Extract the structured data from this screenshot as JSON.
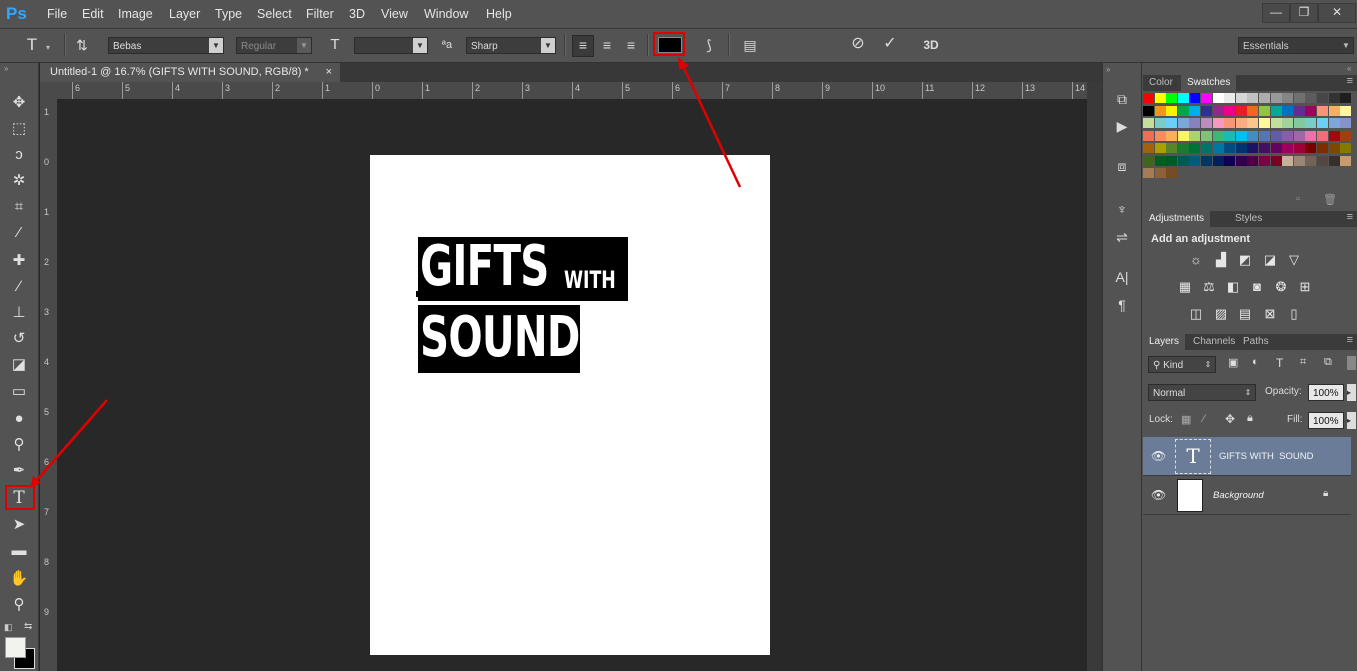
{
  "app": {
    "logo": "Ps"
  },
  "menu": [
    "File",
    "Edit",
    "Image",
    "Layer",
    "Type",
    "Select",
    "Filter",
    "3D",
    "View",
    "Window",
    "Help"
  ],
  "window_controls": {
    "minimize": "—",
    "restore": "❐",
    "close": "✕"
  },
  "options": {
    "font_family": "Bebas",
    "font_style": "Regular",
    "font_size": "",
    "antialias": "Sharp",
    "text_color": "#000000",
    "workspace": "Essentials"
  },
  "document": {
    "tab_title": "Untitled-1 @ 16.7% (GIFTS WITH  SOUND, RGB/8) *",
    "tab_close": "×",
    "line1_big": "GIFTS",
    "line1_small": "WITH",
    "line2": "SOUND"
  },
  "ruler": {
    "h": [
      "6",
      "5",
      "4",
      "3",
      "2",
      "1",
      "0",
      "1",
      "2",
      "3",
      "4",
      "5",
      "6",
      "7",
      "8",
      "9",
      "10",
      "11",
      "12",
      "13",
      "14"
    ],
    "v": [
      "1",
      "0",
      "1",
      "2",
      "3",
      "4",
      "5",
      "6",
      "7",
      "8",
      "9"
    ]
  },
  "panels": {
    "color_tab": "Color",
    "swatches_tab": "Swatches",
    "adjustments_tab": "Adjustments",
    "styles_tab": "Styles",
    "add_adjustment": "Add an adjustment",
    "layers_tab": "Layers",
    "channels_tab": "Channels",
    "paths_tab": "Paths",
    "kind_label": "Kind",
    "blend_mode": "Normal",
    "opacity_label": "Opacity:",
    "opacity_value": "100%",
    "lock_label": "Lock:",
    "fill_label": "Fill:",
    "fill_value": "100%"
  },
  "layers": [
    {
      "name": "GIFTS WITH  SOUND",
      "type": "text",
      "selected": true
    },
    {
      "name": "Background",
      "type": "background",
      "locked": true
    }
  ],
  "swatch_colors": [
    [
      "#ff0000",
      "#ffff00",
      "#00ff00",
      "#00ffff",
      "#0000ff",
      "#ff00ff",
      "#ffffff",
      "#ebebeb",
      "#d6d6d6",
      "#c2c2c2",
      "#adadad",
      "#999999",
      "#858585",
      "#707070",
      "#5c5c5c",
      "#474747",
      "#333333",
      "#1f1f1f"
    ],
    [
      "#000000",
      "#f7941d",
      "#fff200",
      "#00a651",
      "#00aeef",
      "#2e3192",
      "#92278f",
      "#ec008c",
      "#ed1c24",
      "#f26522",
      "#8dc63f",
      "#00a99d",
      "#0072bc",
      "#662d91",
      "#9e005d",
      "#f69679",
      "#fbaf5d",
      "#fff799"
    ],
    [
      "#c4df9b",
      "#7accc8",
      "#6dcff6",
      "#7da7d9",
      "#8781bd",
      "#bd8cbf",
      "#f49ac1",
      "#f7977a",
      "#f9ad81",
      "#fdc68a",
      "#fff79a",
      "#c4df9b",
      "#a2d39c",
      "#82ca9c",
      "#7bcdc8",
      "#6ecff6",
      "#7ea7d8",
      "#8493ca"
    ],
    [
      "#f26c4f",
      "#f68e55",
      "#fbaf5c",
      "#fff467",
      "#acd372",
      "#7cc576",
      "#3bb878",
      "#1abbb4",
      "#00bff3",
      "#438ccb",
      "#5574b9",
      "#605ca8",
      "#855fa8",
      "#a763a8",
      "#f06ea9",
      "#f26d7d",
      "#9e0b0f",
      "#a0410d"
    ],
    [
      "#a36209",
      "#aba000",
      "#598527",
      "#1a7b30",
      "#007236",
      "#00746b",
      "#0076a3",
      "#004b80",
      "#003471",
      "#1b1464",
      "#440e62",
      "#630460",
      "#9e005d",
      "#9e0039",
      "#790000",
      "#7b2e00",
      "#7d4900",
      "#827b00"
    ],
    [
      "#406618",
      "#005e20",
      "#005826",
      "#005952",
      "#005b7f",
      "#003663",
      "#002157",
      "#0d004c",
      "#32004b",
      "#4b0049",
      "#7b0046",
      "#7a0026",
      "#c7b299",
      "#998675",
      "#736357",
      "#534741",
      "#362f2d",
      "#c69c6d"
    ],
    [
      "#a67c52",
      "#8c6239",
      "#754c24"
    ]
  ]
}
